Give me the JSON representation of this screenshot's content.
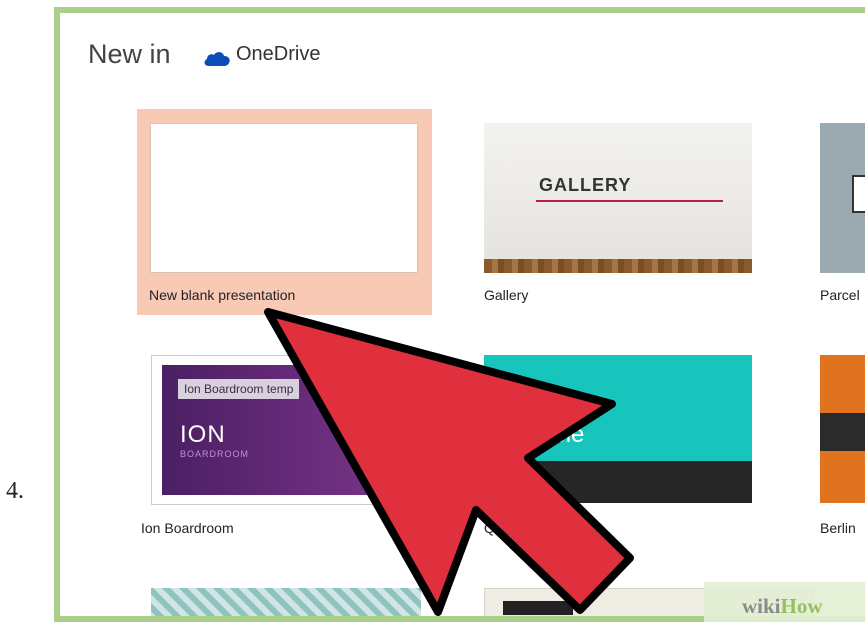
{
  "step_number": "4.",
  "header": {
    "title": "New in",
    "service_icon": "onedrive-cloud-icon",
    "service_label": "OneDrive"
  },
  "templates": [
    {
      "label": "New blank presentation",
      "selected": true
    },
    {
      "label": "Gallery",
      "thumb_title": "GALLERY"
    },
    {
      "label": "Parcel"
    },
    {
      "label": "Ion Boardroom",
      "thumb_title": "Ion Boardroom temp",
      "thumb_big": "ION",
      "thumb_small": "BOARDROOM"
    },
    {
      "label": "Qu",
      "thumb_text": "able"
    },
    {
      "label": "Berlin"
    }
  ],
  "annotation": {
    "icon": "red-arrow-pointer-icon",
    "color": "#e0303e"
  },
  "watermark": {
    "text_a": "wiki",
    "text_b": "How"
  },
  "colors": {
    "frame": "#a9cf8b",
    "selection": "#f8c9b4",
    "arrow": "#e0303e"
  }
}
